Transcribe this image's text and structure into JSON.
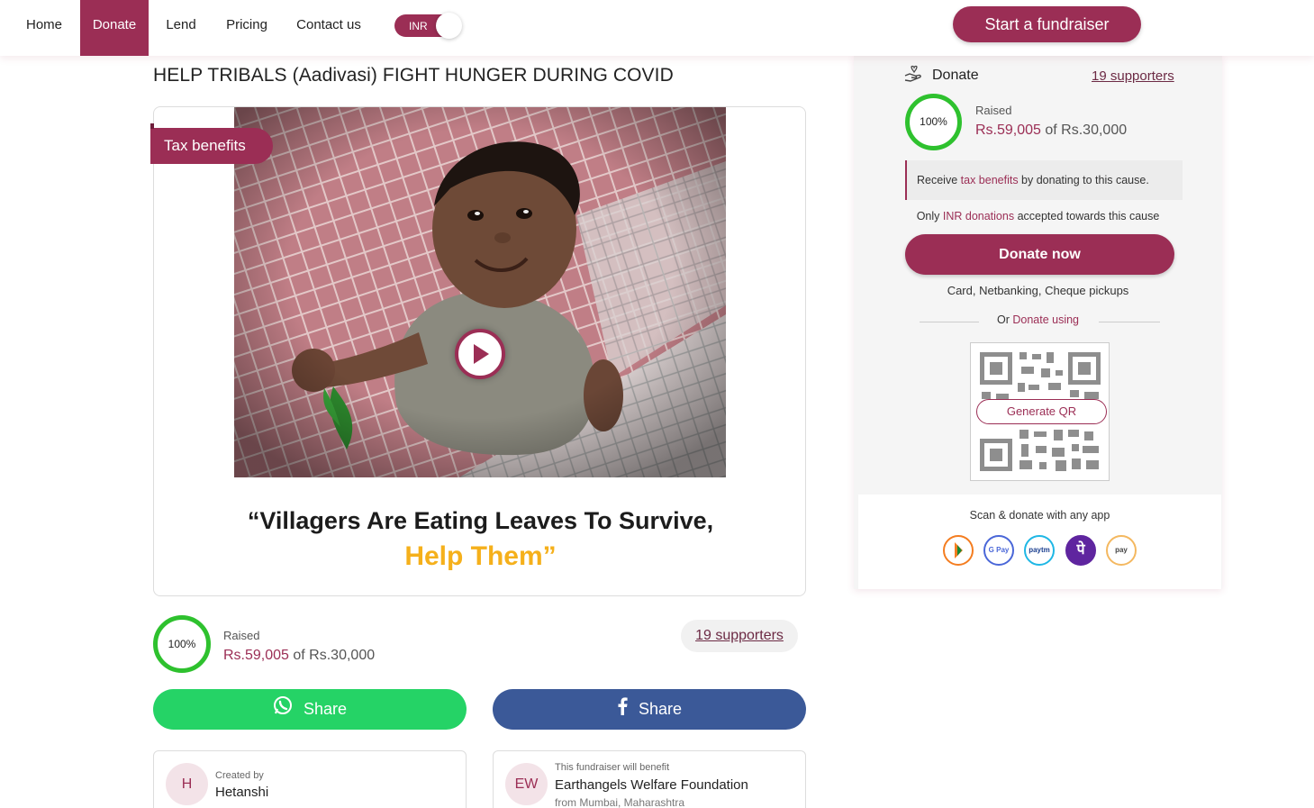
{
  "nav": {
    "items": [
      {
        "label": "Home",
        "active": false
      },
      {
        "label": "Donate",
        "active": true
      },
      {
        "label": "Lend",
        "active": false
      },
      {
        "label": "Pricing",
        "active": false
      },
      {
        "label": "Contact us",
        "active": false
      }
    ],
    "currency_toggle": "INR",
    "start_fundraiser": "Start a fundraiser"
  },
  "campaign": {
    "title": "HELP TRIBALS (Aadivasi) FIGHT HUNGER DURING COVID",
    "tax_badge": "Tax benefits",
    "quote_line1": "“Villagers Are Eating Leaves To Survive,",
    "quote_line2": "Help Them”",
    "progress_percent": "100%",
    "raised_label": "Raised",
    "raised_amount": "Rs.59,005",
    "raised_of": "of Rs.30,000",
    "supporters": "19 supporters",
    "share_whatsapp": "Share",
    "share_facebook": "Share",
    "creator": {
      "initial": "H",
      "label": "Created by",
      "name": "Hetanshi"
    },
    "beneficiary": {
      "initials": "EW",
      "label": "This fundraiser will benefit",
      "name": "Earthangels Welfare Foundation",
      "location": "from Mumbai, Maharashtra"
    }
  },
  "sidebar": {
    "donate_label": "Donate",
    "supporters": "19 supporters",
    "progress_percent": "100%",
    "raised_label": "Raised",
    "raised_amount": "Rs.59,005",
    "raised_of": "of Rs.30,000",
    "tax_pre": "Receive ",
    "tax_link": "tax benefits",
    "tax_post": " by donating to this cause.",
    "inr_pre": "Only ",
    "inr_link": "INR donations",
    "inr_post": " accepted towards this cause",
    "donate_now": "Donate now",
    "methods": "Card, Netbanking, Cheque pickups",
    "or_pre": "Or ",
    "or_link": "Donate using",
    "generate_qr": "Generate QR",
    "scan_text": "Scan & donate with any app",
    "apps": [
      {
        "icon": "bhim-icon",
        "label": "",
        "color": "#f47d20"
      },
      {
        "icon": "gpay-icon",
        "label": "G Pay",
        "color": "#4a67d8"
      },
      {
        "icon": "paytm-icon",
        "label": "paytm",
        "color": "#1fb7e5"
      },
      {
        "icon": "phonepe-icon",
        "label": "पे",
        "color": "#5f259f"
      },
      {
        "icon": "amazon-pay-icon",
        "label": "pay",
        "color": "#f4b860"
      }
    ]
  },
  "colors": {
    "brand": "#9b2e55",
    "progress": "#2ec12e",
    "whatsapp": "#25d366",
    "facebook": "#3b5998"
  }
}
